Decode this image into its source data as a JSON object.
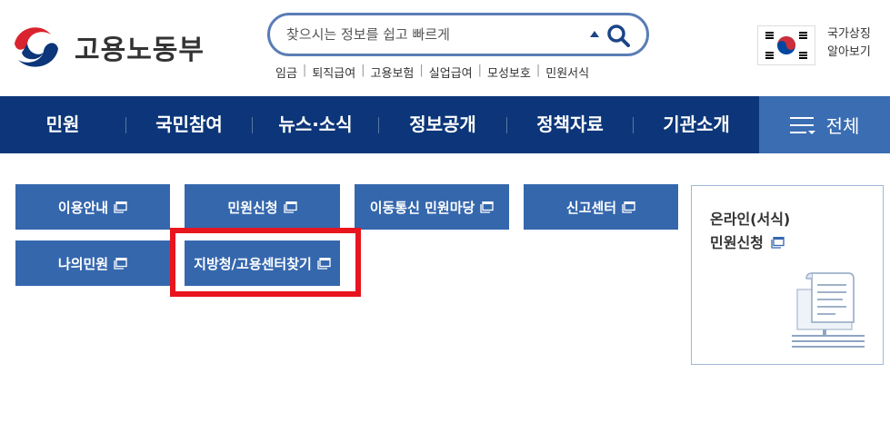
{
  "header": {
    "logo_text": "고용노동부",
    "search_placeholder": "찾으시는 정보를 쉽고 빠르게",
    "quick_links": [
      "임금",
      "퇴직급여",
      "고용보험",
      "실업급여",
      "모성보호",
      "민원서식"
    ],
    "national_symbol_line1": "국가상징",
    "national_symbol_line2": "알아보기"
  },
  "gnb": {
    "items": [
      "민원",
      "국민참여",
      "뉴스·소식",
      "정보공개",
      "정책자료",
      "기관소개"
    ],
    "all_label": "전체"
  },
  "submenu": {
    "buttons": [
      "이용안내",
      "민원신청",
      "이동통신 민원마당",
      "신고센터",
      "나의민원",
      "지방청/고용센터찾기"
    ]
  },
  "side_card": {
    "title_line1": "온라인(서식)",
    "title_line2": "민원신청"
  },
  "colors": {
    "navy": "#0c3679",
    "button_blue": "#3567ad",
    "all_menu_blue": "#3b6db2",
    "highlight_red": "#e8141e"
  }
}
